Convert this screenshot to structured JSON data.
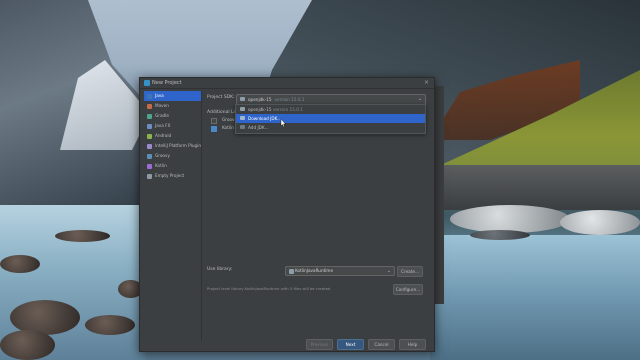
{
  "dialog": {
    "title": "New Project",
    "close_glyph": "×"
  },
  "sidebar": {
    "items": [
      {
        "label": "Java",
        "icon": "folder-icon",
        "color": "#3a77b8",
        "selected": true
      },
      {
        "label": "Maven",
        "icon": "maven-icon",
        "color": "#c26c48"
      },
      {
        "label": "Gradle",
        "icon": "gradle-icon",
        "color": "#4ca58d"
      },
      {
        "label": "Java FX",
        "icon": "javafx-icon",
        "color": "#6c8fc2"
      },
      {
        "label": "Android",
        "icon": "android-icon",
        "color": "#8ab44b"
      },
      {
        "label": "IntelliJ Platform Plugin",
        "icon": "plugin-icon",
        "color": "#9b8ad0"
      },
      {
        "label": "Groovy",
        "icon": "groovy-icon",
        "color": "#5d8fb4"
      },
      {
        "label": "Kotlin",
        "icon": "kotlin-icon",
        "color": "#9e6ad6"
      },
      {
        "label": "Empty Project",
        "icon": "empty-project-icon",
        "color": "#8e9aa3"
      }
    ]
  },
  "content": {
    "sdk_label": "Project SDK:",
    "sdk_value": "openjdk-15",
    "sdk_version": "version 15.0.1",
    "additional_label": "Additional Lib",
    "libs": [
      {
        "label": "Groov",
        "checked": false
      },
      {
        "label": "Kotlin",
        "checked": true
      }
    ],
    "sdk_dropdown": [
      {
        "label": "openjdk-15",
        "version": "version 15.0.1",
        "icon": "folder-icon",
        "highlighted": false
      },
      {
        "label": "Download JDK...",
        "icon": "download-icon",
        "highlighted": true
      },
      {
        "label": "Add JDK...",
        "icon": "add-icon",
        "highlighted": false
      }
    ],
    "use_library_label": "Use library:",
    "use_library_value": "KotlinJavaRuntime",
    "create_button": "Create...",
    "library_note": "Project level library KotlinJavaRuntime with 5 files will be created",
    "configure_button": "Configure..."
  },
  "footer": {
    "previous": "Previous",
    "next": "Next",
    "cancel": "Cancel",
    "help": "Help"
  },
  "colors": {
    "accent": "#2f65ca",
    "dialog_bg": "#3c3f41",
    "primary_button": "#365880"
  }
}
